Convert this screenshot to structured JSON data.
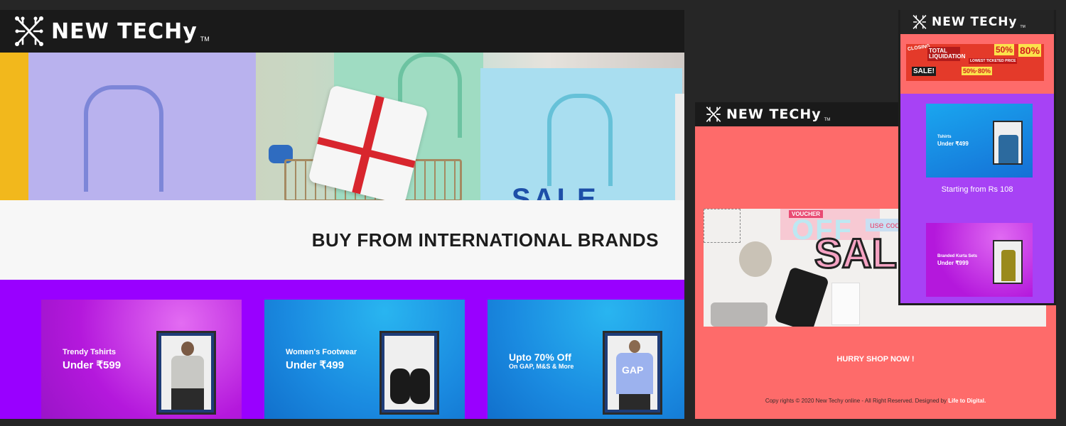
{
  "brand": {
    "name": "NEW TECHy",
    "tm": "TM"
  },
  "desktop": {
    "banner_text": "BUY FROM INTERNATIONAL BRANDS",
    "hero_sign": "SALE",
    "tiles": [
      {
        "small": "Trendy Tshirts",
        "big": "Under ₹599",
        "bg": "#c020e6"
      },
      {
        "small": "Women's Footwear",
        "big": "Under ₹499",
        "bg": "#1290e4"
      },
      {
        "small": "Upto 70% Off",
        "big": "On GAP, M&S & More",
        "bg": "#1290e4"
      }
    ],
    "gap_label": "GAP"
  },
  "tablet": {
    "img_texts": {
      "voucher": "VOUCHER",
      "off": "OFF",
      "code": "use code",
      "sale": "SAL"
    },
    "hurry": "HURRY SHOP NOW !",
    "copyright": "Copy rights © 2020 New Techy online - All Right Reserved. Designed by",
    "copyright_link": "Life to Digital."
  },
  "phone": {
    "sale_texts": [
      "TOTAL LIQUIDATION",
      "50%",
      "80%",
      "50%·80%",
      "SALE!",
      "LOWEST TICKETED PRICE",
      "CLOSING"
    ],
    "tiles": [
      {
        "small": "Tshirts",
        "big": "Under ₹499"
      },
      {
        "small": "Branded Kurta Sets",
        "big": "Under ₹999"
      }
    ],
    "starting": "Starting from Rs 108"
  },
  "colors": {
    "purple": "#9900ff",
    "coral": "#fe6b6a",
    "phone_purple": "#a742f5",
    "header": "#1a1a1a"
  }
}
